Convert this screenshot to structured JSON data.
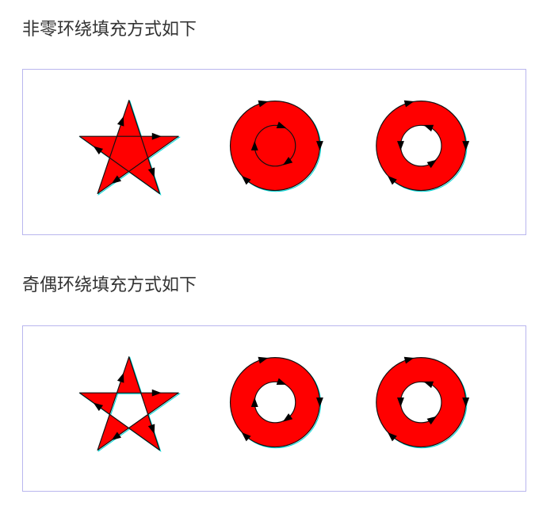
{
  "sections": [
    {
      "title": "非零环绕填充方式如下",
      "rule": "nonzero"
    },
    {
      "title": "奇偶环绕填充方式如下",
      "rule": "evenodd"
    }
  ],
  "colors": {
    "fill": "#ff0000",
    "stroke": "#111111",
    "highlight": "#00d6d6",
    "arrow": "#000000",
    "border": "#b9b6ee",
    "text": "#333333"
  },
  "icons": [
    "star-shape",
    "ring-shape-same-direction",
    "ring-shape-opposite-direction"
  ]
}
